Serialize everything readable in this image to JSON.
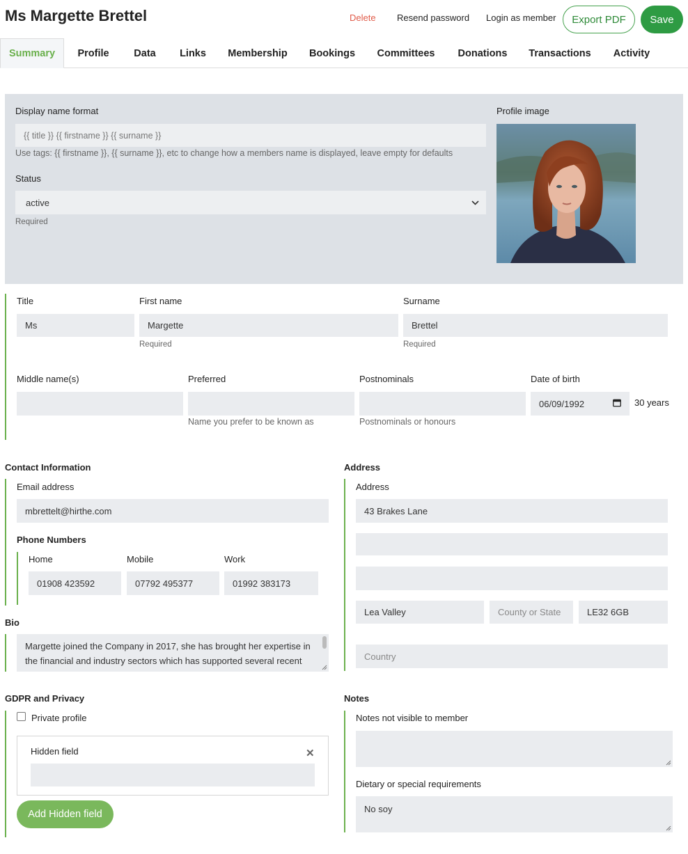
{
  "header": {
    "title": "Ms Margette Brettel",
    "delete_label": "Delete",
    "resend_label": "Resend password",
    "login_label": "Login as member",
    "export_label": "Export PDF",
    "save_label": "Save"
  },
  "tabs": [
    {
      "label": "Summary"
    },
    {
      "label": "Profile"
    },
    {
      "label": "Data"
    },
    {
      "label": "Links"
    },
    {
      "label": "Membership"
    },
    {
      "label": "Bookings"
    },
    {
      "label": "Committees"
    },
    {
      "label": "Donations"
    },
    {
      "label": "Transactions"
    },
    {
      "label": "Activity"
    }
  ],
  "display": {
    "label": "Display name format",
    "placeholder": "{{ title }} {{ firstname }} {{ surname }}",
    "hint": "Use tags: {{ firstname }}, {{ surname }}, etc to change how a members name is displayed, leave empty for defaults"
  },
  "status": {
    "label": "Status",
    "value": "active",
    "hint": "Required"
  },
  "profile_image": {
    "label": "Profile image"
  },
  "name": {
    "title_label": "Title",
    "title_value": "Ms",
    "first_label": "First name",
    "first_value": "Margette",
    "first_hint": "Required",
    "surname_label": "Surname",
    "surname_value": "Brettel",
    "surname_hint": "Required",
    "middle_label": "Middle name(s)",
    "preferred_label": "Preferred",
    "preferred_hint": "Name you prefer to be known as",
    "postnominals_label": "Postnominals",
    "postnominals_hint": "Postnominals or honours",
    "dob_label": "Date of birth",
    "dob_value": "06/09/1992",
    "age": "30 years"
  },
  "contact": {
    "title": "Contact Information",
    "email_label": "Email address",
    "email_value": "mbrettelt@hirthe.com",
    "phone_title": "Phone Numbers",
    "home_label": "Home",
    "home_value": "01908 423592",
    "mobile_label": "Mobile",
    "mobile_value": "07792 495377",
    "work_label": "Work",
    "work_value": "01992 383173"
  },
  "bio": {
    "title": "Bio",
    "text": "Margette joined the Company in 2017, she has brought her expertise in the financial and industry sectors which has supported several recent"
  },
  "address": {
    "title": "Address",
    "label": "Address",
    "line1": "43 Brakes Lane",
    "line2": "",
    "line3": "",
    "town": "Lea Valley",
    "county_placeholder": "County or State",
    "postcode": "LE32 6GB",
    "country_placeholder": "Country"
  },
  "gdpr": {
    "title": "GDPR and Privacy",
    "private_label": "Private profile",
    "hidden_label": "Hidden field",
    "add_label": "Add Hidden field"
  },
  "notes": {
    "title": "Notes",
    "private_label": "Notes not visible to member",
    "dietary_label": "Dietary or special requirements",
    "dietary_value": "No soy"
  },
  "colors": {
    "accent_green": "#6ab04c",
    "save_green": "#2e9b43",
    "delete_red": "#e05a48",
    "panel_grey": "#dde1e6",
    "input_grey": "#eaecef"
  }
}
